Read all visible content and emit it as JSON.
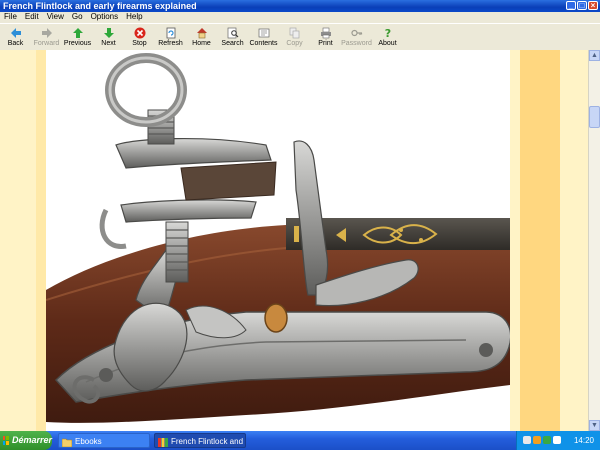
{
  "window": {
    "title": "French Flintlock and early firearms explained"
  },
  "menu": [
    "File",
    "Edit",
    "View",
    "Go",
    "Options",
    "Help"
  ],
  "toolbar": {
    "buttons": [
      {
        "label": "Back",
        "icon": "back-arrow-icon",
        "enabled": true
      },
      {
        "label": "Forward",
        "icon": "forward-arrow-icon",
        "enabled": false
      },
      {
        "label": "Previous",
        "icon": "up-arrow-icon",
        "enabled": true
      },
      {
        "label": "Next",
        "icon": "down-arrow-icon",
        "enabled": true
      },
      {
        "label": "Stop",
        "icon": "stop-icon",
        "enabled": true
      },
      {
        "label": "Refresh",
        "icon": "refresh-icon",
        "enabled": true
      },
      {
        "label": "Home",
        "icon": "home-icon",
        "enabled": true
      },
      {
        "label": "Search",
        "icon": "search-icon",
        "enabled": true
      },
      {
        "label": "Contents",
        "icon": "contents-icon",
        "enabled": true
      },
      {
        "label": "Copy",
        "icon": "copy-icon",
        "enabled": false
      },
      {
        "label": "Print",
        "icon": "print-icon",
        "enabled": true
      },
      {
        "label": "Password",
        "icon": "key-icon",
        "enabled": false
      },
      {
        "label": "About",
        "icon": "question-icon",
        "enabled": true
      }
    ]
  },
  "colors": {
    "titlebar": "#0a3fb8",
    "page_band_light": "#fff3c6",
    "page_band_dark": "#ffd780",
    "taskbar": "#245edc",
    "start_green": "#2f8f2a"
  },
  "taskbar": {
    "start_label": "Démarrer",
    "tasks": [
      {
        "label": "Ebooks",
        "icon": "folder-icon"
      },
      {
        "label": "French Flintlock and e...",
        "icon": "ebook-icon"
      }
    ],
    "clock": "14:20"
  }
}
